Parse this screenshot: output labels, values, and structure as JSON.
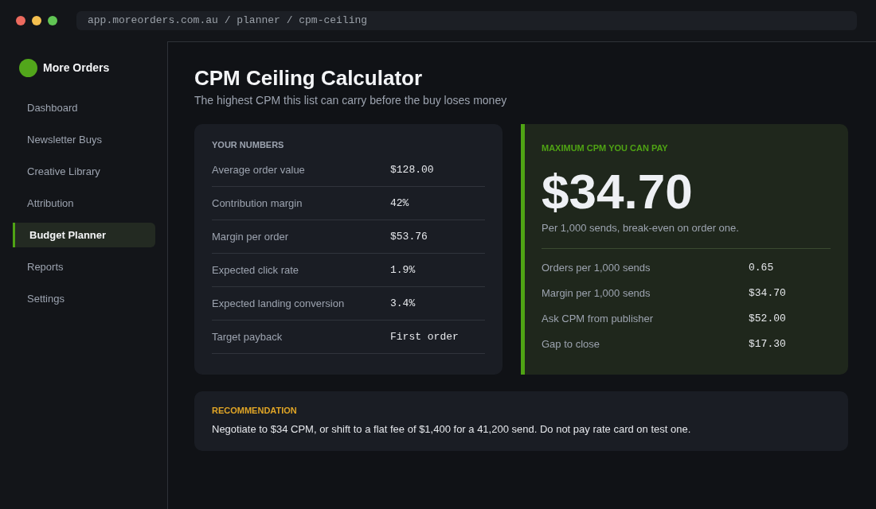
{
  "browser": {
    "url": "app.moreorders.com.au / planner / cpm-ceiling"
  },
  "sidebar": {
    "brand": "More Orders",
    "items": [
      {
        "label": "Dashboard",
        "selected": false
      },
      {
        "label": "Newsletter Buys",
        "selected": false
      },
      {
        "label": "Creative Library",
        "selected": false
      },
      {
        "label": "Attribution",
        "selected": false
      },
      {
        "label": "Budget Planner",
        "selected": true
      },
      {
        "label": "Reports",
        "selected": false
      },
      {
        "label": "Settings",
        "selected": false
      }
    ]
  },
  "page": {
    "title": "CPM Ceiling Calculator",
    "subtitle": "The highest CPM this list can carry before the buy loses money"
  },
  "inputs_card": {
    "heading": "YOUR NUMBERS",
    "rows": [
      {
        "label": "Average order value",
        "value": "$128.00"
      },
      {
        "label": "Contribution margin",
        "value": "42%"
      },
      {
        "label": "Margin per order",
        "value": "$53.76"
      },
      {
        "label": "Expected click rate",
        "value": "1.9%"
      },
      {
        "label": "Expected landing conversion",
        "value": "3.4%"
      },
      {
        "label": "Target payback",
        "value": "First order"
      }
    ]
  },
  "result_card": {
    "heading": "MAXIMUM CPM YOU CAN PAY",
    "amount": "$34.70",
    "note": "Per 1,000 sends, break-even on order one.",
    "rows": [
      {
        "label": "Orders per 1,000 sends",
        "value": "0.65"
      },
      {
        "label": "Margin per 1,000 sends",
        "value": "$34.70"
      },
      {
        "label": "Ask CPM from publisher",
        "value": "$52.00"
      },
      {
        "label": "Gap to close",
        "value": "$17.30"
      }
    ]
  },
  "recommendation": {
    "heading": "RECOMMENDATION",
    "text": "Negotiate to $34 CPM, or shift to a flat fee of $1,400 for a 41,200 send. Do not pay rate card on test one."
  }
}
